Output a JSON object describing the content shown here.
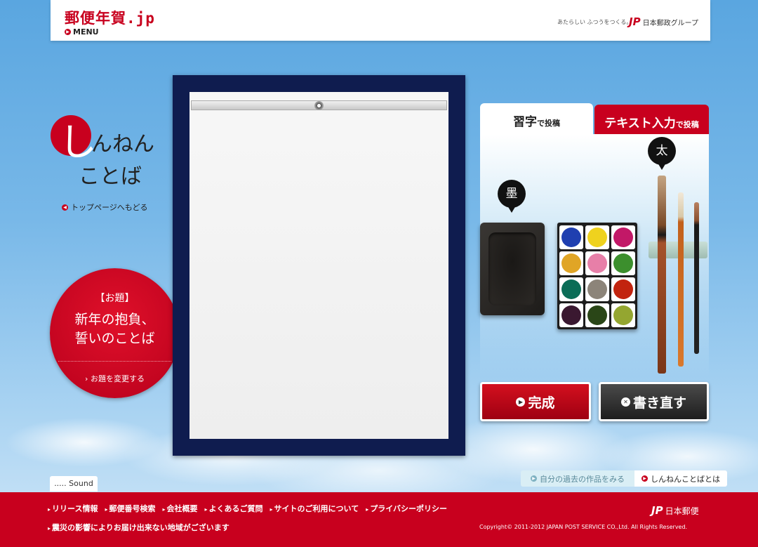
{
  "header": {
    "logo": "郵便年賀.jp",
    "menu_label": "MENU",
    "tagline": "あたらしい ふつうをつくる。",
    "group_logo_mark": "JP",
    "group_name": "日本郵政グループ"
  },
  "title": {
    "line1_big": "し",
    "line1_rest": "んねん",
    "line2": "ことば",
    "back_link": "トップページへもどる"
  },
  "topic": {
    "label": "【お題】",
    "text_line1": "新年の抱負、",
    "text_line2": "誓いのことば",
    "change_link": "お題を変更する"
  },
  "tabs": [
    {
      "big": "習字",
      "small": "で投稿"
    },
    {
      "big": "テキスト入力",
      "small": "で投稿"
    }
  ],
  "tools": {
    "ink_label": "墨",
    "brush_label": "太"
  },
  "palette_colors": [
    "#1f3fb0",
    "#efd21e",
    "#c21867",
    "#e0a526",
    "#e77fa8",
    "#3c8f2d",
    "#0b6d57",
    "#8c8479",
    "#c2240f",
    "#3a1830",
    "#2a4617",
    "#94a630"
  ],
  "buttons": {
    "done": "完成",
    "redo": "書き直す"
  },
  "bottom": {
    "sound": "..... Sound",
    "past_works": "自分の過去の作品をみる",
    "about": "しんねんことばとは"
  },
  "footer": {
    "links": [
      "リリース情報",
      "郵便番号検索",
      "会社概要",
      "よくあるご質問",
      "サイトのご利用について",
      "プライバシーポリシー"
    ],
    "notice": "震災の影響によりお届け出来ない地域がございます",
    "logo_mark": "JP",
    "logo_name": "日本郵便",
    "copyright": "Copyright© 2011-2012 JAPAN POST SERVICE CO.,Ltd. All Rights Reserved."
  }
}
